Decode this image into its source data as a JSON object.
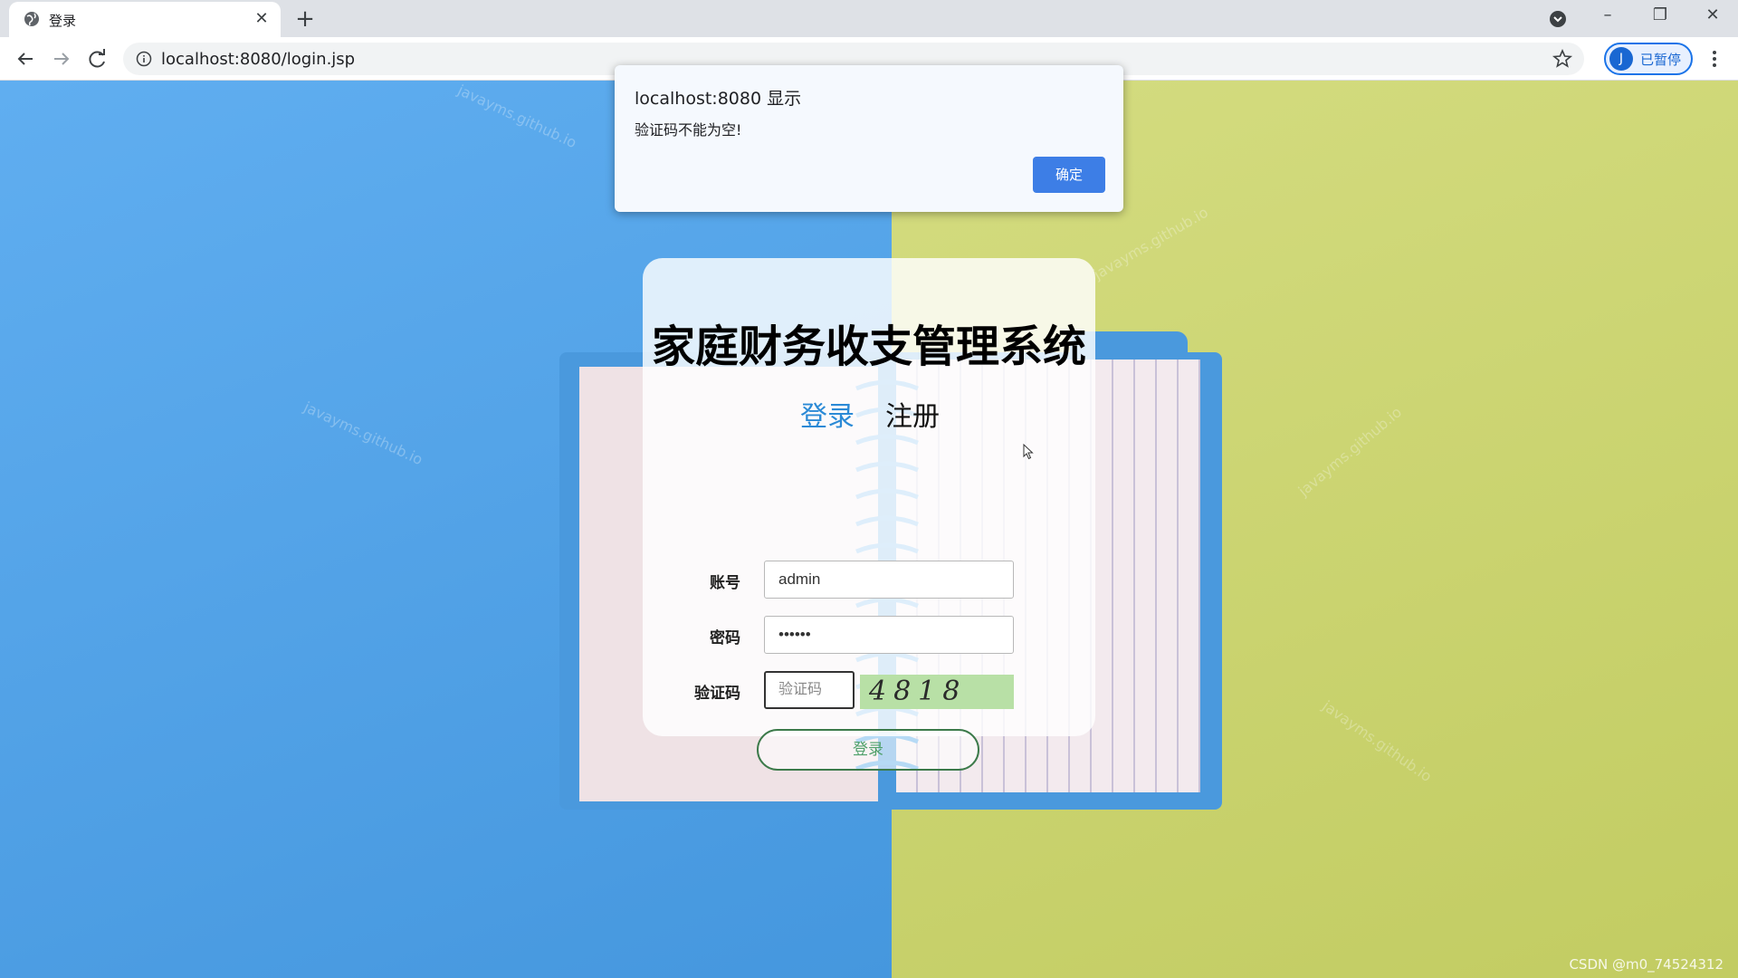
{
  "browser": {
    "tab_title": "登录",
    "url": "localhost:8080/login.jsp",
    "profile_initial": "J",
    "profile_label": "已暂停"
  },
  "alert": {
    "title": "localhost:8080 显示",
    "message": "验证码不能为空!",
    "ok_label": "确定"
  },
  "login_card": {
    "system_title": "家庭财务收支管理系统",
    "tabs": {
      "login": "登录",
      "register": "注册"
    },
    "account_label": "账号",
    "account_value": "admin",
    "password_label": "密码",
    "password_value": "••••••",
    "captcha_label": "验证码",
    "captcha_placeholder": "验证码",
    "captcha_code": "4818",
    "submit_label": "登录"
  },
  "watermark_text": "javayms.github.io",
  "footer": "CSDN @m0_74524312",
  "colors": {
    "accent_blue": "#2b8ad6",
    "dialog_button": "#3d7ee6",
    "captcha_bg": "#b8e0a6",
    "login_button_border": "#3c7a4a"
  }
}
